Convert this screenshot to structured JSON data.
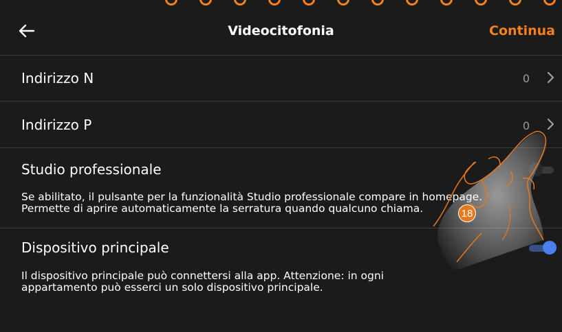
{
  "colors": {
    "accent": "#f2811e",
    "toggle_on": "#4a7ff0",
    "background": "#1b1b1b",
    "badge": "#e8791b"
  },
  "header": {
    "title": "Videocitofonia",
    "continue_label": "Continua",
    "back_icon": "arrow-left-icon"
  },
  "rows": [
    {
      "label": "Indirizzo N",
      "value": "0"
    },
    {
      "label": "Indirizzo P",
      "value": "0"
    }
  ],
  "studio": {
    "label": "Studio professionale",
    "description": "Se abilitato, il pulsante per la funzionalità Studio professionale compare in homepage.\nPermette di aprire automaticamente la serratura quando qualcuno chiama.",
    "enabled": false
  },
  "principale": {
    "label": "Dispositivo principale",
    "description": "Il dispositivo principale può connettersi alla app. Attenzione: in ogni\nappartamento può esserci un solo dispositivo principale.",
    "enabled": true
  },
  "callout": {
    "number": "18"
  }
}
